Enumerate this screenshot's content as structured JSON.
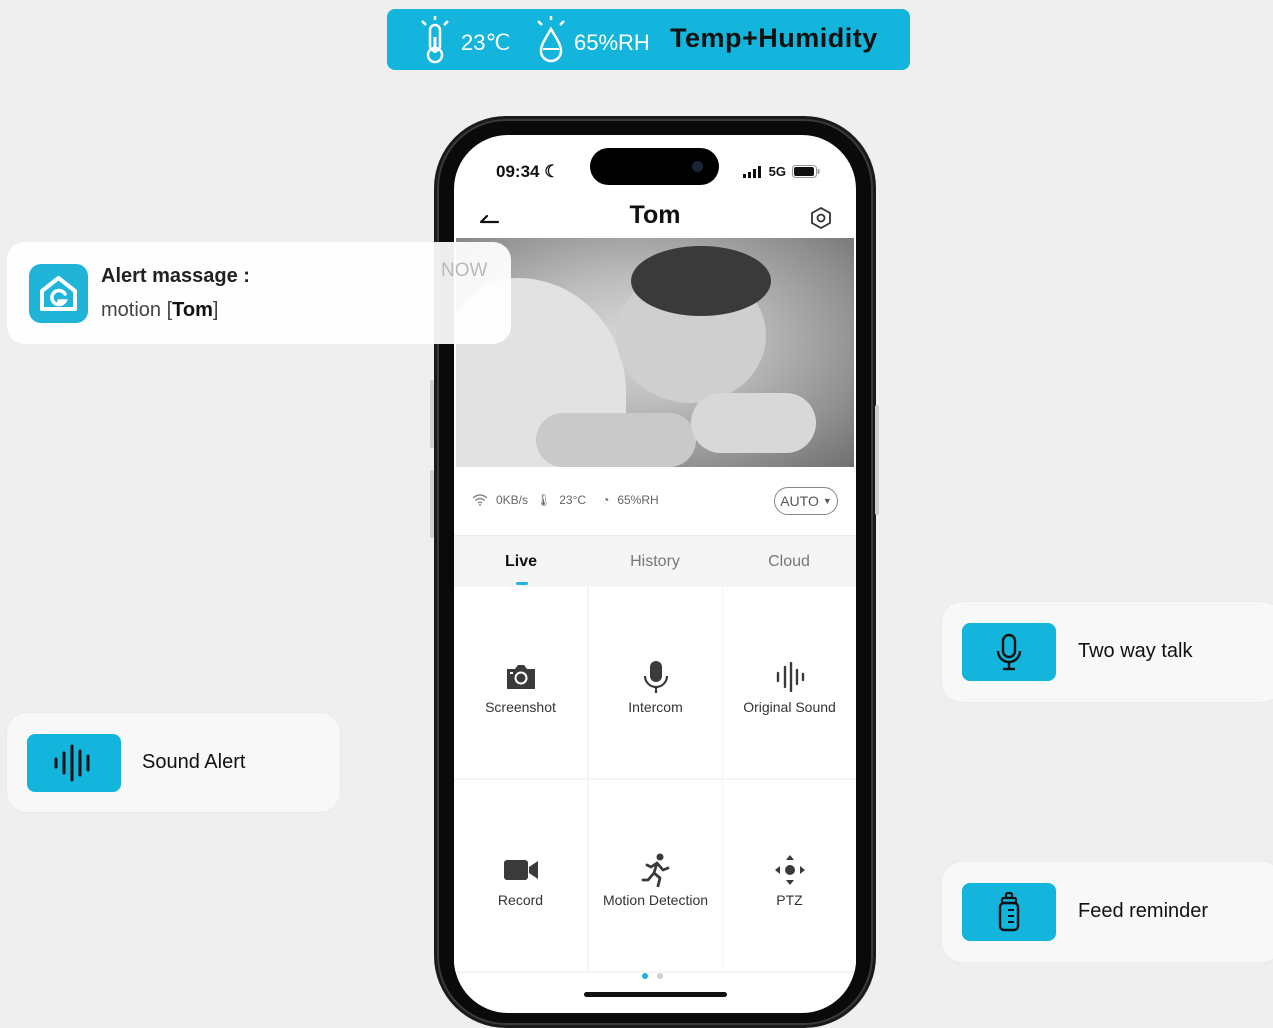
{
  "banner": {
    "temperature": "23℃",
    "humidity": "65%RH",
    "label": "Temp+Humidity"
  },
  "alert": {
    "title": "Alert massage :",
    "body_prefix": "motion [",
    "body_name": "Tom",
    "body_suffix": "]",
    "time": "NOW"
  },
  "features": {
    "two_way_talk": "Two way talk",
    "sound_alert": "Sound Alert",
    "feed_reminder": "Feed reminder"
  },
  "phone": {
    "status": {
      "time": "09:34",
      "network": "5G"
    },
    "nav": {
      "title": "Tom"
    },
    "info": {
      "speed": "0KB/s",
      "temperature": "23°C",
      "humidity": "65%RH",
      "quality": "AUTO"
    },
    "tabs": [
      {
        "label": "Live",
        "active": true
      },
      {
        "label": "History",
        "active": false
      },
      {
        "label": "Cloud",
        "active": false
      }
    ],
    "controls": [
      {
        "label": "Screenshot",
        "icon": "camera-icon"
      },
      {
        "label": "Intercom",
        "icon": "microphone-icon"
      },
      {
        "label": "Original Sound",
        "icon": "sound-wave-icon"
      },
      {
        "label": "Record",
        "icon": "video-camera-icon"
      },
      {
        "label": "Motion Detection",
        "icon": "running-person-icon"
      },
      {
        "label": "PTZ",
        "icon": "directional-pad-icon"
      }
    ],
    "page_dots": {
      "count": 2,
      "active": 0
    }
  },
  "colors": {
    "accent": "#14b5dc",
    "background": "#efefef"
  }
}
